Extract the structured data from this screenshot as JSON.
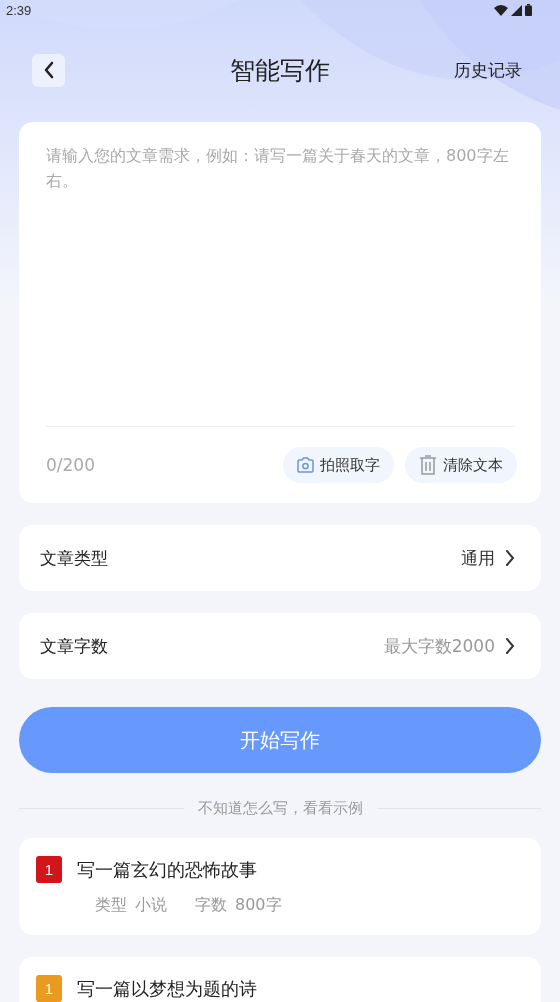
{
  "status_bar": {
    "time": "2:39"
  },
  "header": {
    "title": "智能写作",
    "history_link": "历史记录"
  },
  "editor": {
    "placeholder": "请输入您的文章需求，例如：请写一篇关于春天的文章，800字左右。",
    "counter": "0/200",
    "actions": [
      {
        "kind": "camera",
        "label": "拍照取字"
      },
      {
        "kind": "trash",
        "label": "清除文本"
      }
    ]
  },
  "settings": [
    {
      "label": "文章类型",
      "value": "通用",
      "muted": false
    },
    {
      "label": "文章字数",
      "value": "最大字数2000",
      "muted": true
    }
  ],
  "start_button": "开始写作",
  "examples_divider": "不知道怎么写，看看示例",
  "examples": [
    {
      "rank": "1",
      "color": "#d0161b",
      "title": "写一篇玄幻的恐怖故事",
      "type_label": "类型",
      "type_value": "小说",
      "count_label": "字数",
      "count_value": "800字"
    },
    {
      "rank": "1",
      "color": "#e99a1f",
      "title": "写一篇以梦想为题的诗"
    }
  ]
}
